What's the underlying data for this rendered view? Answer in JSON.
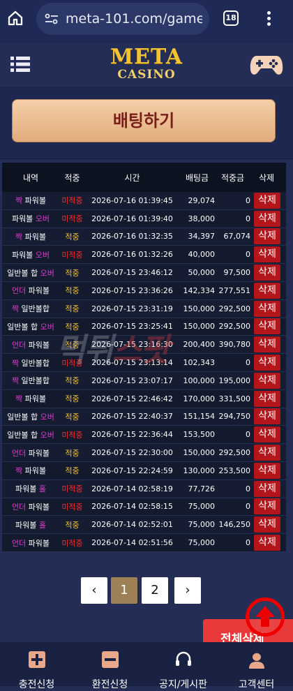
{
  "browser": {
    "url": "meta-101.com/game_l",
    "tab_count": "18"
  },
  "header": {
    "logo_top": "META",
    "logo_bottom": "CASINO"
  },
  "bet_button": "배팅하기",
  "table": {
    "headers": [
      "내역",
      "적중",
      "시간",
      "배팅금",
      "적중금",
      "삭제"
    ],
    "delete_label": "삭제",
    "rows": [
      {
        "parts": [
          {
            "t": "짝",
            "c": "magenta"
          },
          {
            "t": " 파워볼",
            "c": ""
          }
        ],
        "status": "미적중",
        "time": "2026-07-16 01:39:45",
        "bet": "29,074",
        "win": "0"
      },
      {
        "parts": [
          {
            "t": "파워볼 ",
            "c": ""
          },
          {
            "t": "오버",
            "c": "magenta"
          }
        ],
        "status": "미적중",
        "time": "2026-07-16 01:39:40",
        "bet": "38,000",
        "win": "0"
      },
      {
        "parts": [
          {
            "t": "짝",
            "c": "magenta"
          },
          {
            "t": " 파워볼",
            "c": ""
          }
        ],
        "status": "적중",
        "time": "2026-07-16 01:32:35",
        "bet": "34,397",
        "win": "67,074"
      },
      {
        "parts": [
          {
            "t": "파워볼 ",
            "c": ""
          },
          {
            "t": "오버",
            "c": "magenta"
          }
        ],
        "status": "미적중",
        "time": "2026-07-16 01:32:26",
        "bet": "40,000",
        "win": "0"
      },
      {
        "parts": [
          {
            "t": "일반볼 합 ",
            "c": ""
          },
          {
            "t": "오버",
            "c": "magenta"
          }
        ],
        "status": "적중",
        "time": "2026-07-15 23:46:12",
        "bet": "50,000",
        "win": "97,500"
      },
      {
        "parts": [
          {
            "t": "언더",
            "c": "magenta"
          },
          {
            "t": " 파워볼",
            "c": ""
          }
        ],
        "status": "적중",
        "time": "2026-07-15 23:36:26",
        "bet": "142,334",
        "win": "277,551"
      },
      {
        "parts": [
          {
            "t": "짝",
            "c": "magenta"
          },
          {
            "t": " 일반볼합",
            "c": ""
          }
        ],
        "status": "적중",
        "time": "2026-07-15 23:31:19",
        "bet": "150,000",
        "win": "292,500"
      },
      {
        "parts": [
          {
            "t": "일반볼 합 ",
            "c": ""
          },
          {
            "t": "오버",
            "c": "magenta"
          }
        ],
        "status": "적중",
        "time": "2026-07-15 23:25:41",
        "bet": "150,000",
        "win": "292,500"
      },
      {
        "parts": [
          {
            "t": "언더",
            "c": "magenta"
          },
          {
            "t": " 파워볼",
            "c": ""
          }
        ],
        "status": "적중",
        "time": "2026-07-15 23:16:30",
        "bet": "200,400",
        "win": "390,780"
      },
      {
        "parts": [
          {
            "t": "짝",
            "c": "magenta"
          },
          {
            "t": " 일반볼합",
            "c": ""
          }
        ],
        "status": "미적중",
        "time": "2026-07-15 23:13:14",
        "bet": "102,343",
        "win": "0"
      },
      {
        "parts": [
          {
            "t": "짝",
            "c": "magenta"
          },
          {
            "t": " 일반볼합",
            "c": ""
          }
        ],
        "status": "적중",
        "time": "2026-07-15 23:07:17",
        "bet": "100,000",
        "win": "195,000"
      },
      {
        "parts": [
          {
            "t": "짝",
            "c": "magenta"
          },
          {
            "t": " 파워볼",
            "c": ""
          }
        ],
        "status": "적중",
        "time": "2026-07-15 22:46:42",
        "bet": "170,000",
        "win": "331,500"
      },
      {
        "parts": [
          {
            "t": "일반볼 합 ",
            "c": ""
          },
          {
            "t": "오버",
            "c": "magenta"
          }
        ],
        "status": "적중",
        "time": "2026-07-15 22:40:37",
        "bet": "151,154",
        "win": "294,750"
      },
      {
        "parts": [
          {
            "t": "일반볼 합 ",
            "c": ""
          },
          {
            "t": "오버",
            "c": "magenta"
          }
        ],
        "status": "미적중",
        "time": "2026-07-15 22:36:44",
        "bet": "153,500",
        "win": "0"
      },
      {
        "parts": [
          {
            "t": "언더",
            "c": "magenta"
          },
          {
            "t": " 파워볼",
            "c": ""
          }
        ],
        "status": "적중",
        "time": "2026-07-15 22:30:00",
        "bet": "150,000",
        "win": "292,500"
      },
      {
        "parts": [
          {
            "t": "짝",
            "c": "magenta"
          },
          {
            "t": " 파워볼",
            "c": ""
          }
        ],
        "status": "적중",
        "time": "2026-07-15 22:24:59",
        "bet": "130,000",
        "win": "253,500"
      },
      {
        "parts": [
          {
            "t": "파워볼 ",
            "c": ""
          },
          {
            "t": "홀",
            "c": "magenta"
          }
        ],
        "status": "미적중",
        "time": "2026-07-14 02:58:19",
        "bet": "77,726",
        "win": "0"
      },
      {
        "parts": [
          {
            "t": "언더",
            "c": "magenta"
          },
          {
            "t": " 파워볼",
            "c": ""
          }
        ],
        "status": "미적중",
        "time": "2026-07-14 02:58:15",
        "bet": "75,000",
        "win": "0"
      },
      {
        "parts": [
          {
            "t": "파워볼 ",
            "c": ""
          },
          {
            "t": "홀",
            "c": "magenta"
          }
        ],
        "status": "적중",
        "time": "2026-07-14 02:52:01",
        "bet": "75,000",
        "win": "146,250"
      },
      {
        "parts": [
          {
            "t": "언더",
            "c": "magenta"
          },
          {
            "t": " 파워볼",
            "c": ""
          }
        ],
        "status": "미적중",
        "time": "2026-07-14 02:51:56",
        "bet": "75,000",
        "win": "0"
      }
    ]
  },
  "watermark": {
    "part1": "먹튀",
    "part2": "스팟"
  },
  "pagination": {
    "prev": "‹",
    "pages": [
      "1",
      "2"
    ],
    "current": "1",
    "next": "›"
  },
  "delete_all": "전체삭제",
  "bottom_nav": [
    {
      "label": "충전신청",
      "icon": "plus-square-icon"
    },
    {
      "label": "환전신청",
      "icon": "minus-square-icon"
    },
    {
      "label": "공지/게시판",
      "icon": "headset-icon"
    },
    {
      "label": "고객센터",
      "icon": "agent-icon"
    }
  ],
  "colors": {
    "hit": "#f4c02a",
    "miss": "#ff2b2b",
    "accent": "#e03bd0",
    "delete": "#b3151a"
  }
}
